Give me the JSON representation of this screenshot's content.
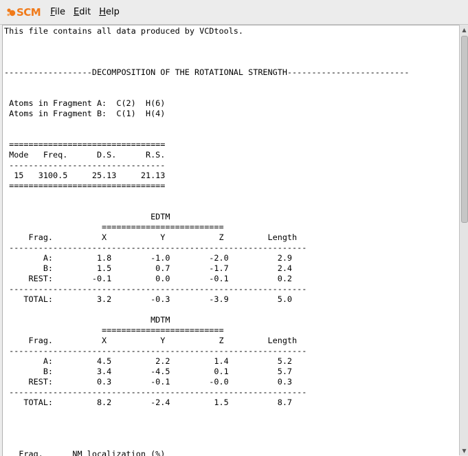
{
  "app": {
    "logo_text": "SCM",
    "logo_color": "#f07a1a"
  },
  "menu": {
    "file": {
      "mnemonic": "F",
      "rest": "ile"
    },
    "edit": {
      "mnemonic": "E",
      "rest": "dit"
    },
    "help": {
      "mnemonic": "H",
      "rest": "elp"
    }
  },
  "report_text": "This file contains all data produced by VCDtools.\n\n\n\n------------------DECOMPOSITION OF THE ROTATIONAL STRENGTH-------------------------\n\n\n Atoms in Fragment A:  C(2)  H(6)\n Atoms in Fragment B:  C(1)  H(4)\n\n\n ================================\n Mode   Freq.      D.S.      R.S.\n --------------------------------\n  15   3100.5     25.13     21.13\n ================================\n\n\n                              EDTM\n                    =========================\n     Frag.          X           Y           Z         Length\n -------------------------------------------------------------\n        A:         1.8        -1.0        -2.0          2.9\n        B:         1.5         0.7        -1.7          2.4\n     REST:        -0.1         0.0        -0.1          0.2\n -------------------------------------------------------------\n    TOTAL:         3.2        -0.3        -3.9          5.0\n\n                              MDTM\n                    =========================\n     Frag.          X           Y           Z         Length\n -------------------------------------------------------------\n        A:         4.5         2.2         1.4          5.2\n        B:         3.4        -4.5         0.1          5.7\n     REST:         0.3        -0.1        -0.0          0.3\n -------------------------------------------------------------\n    TOTAL:         8.2        -2.4         1.5          8.7\n\n\n\n\n   Frag.      NM localization (%)"
}
